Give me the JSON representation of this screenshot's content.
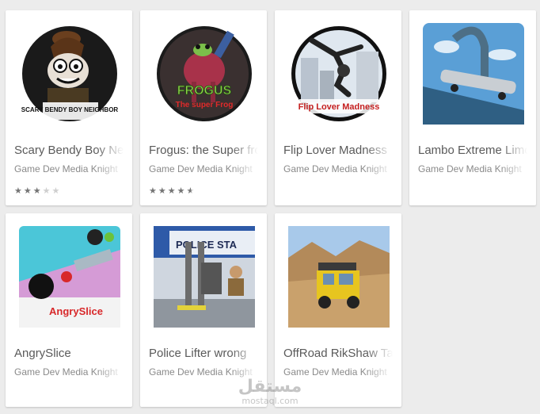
{
  "apps": [
    {
      "title": "Scary Bendy Boy Neighbor",
      "developer": "Game Dev Media Knight",
      "rating_stars": 3,
      "icon_caption": "SCARY BENDY BOY NEIGHBOR",
      "icon": "cartoon-boy-icon"
    },
    {
      "title": "Frogus: the Super frog",
      "developer": "Game Dev Media Knight",
      "rating_stars": 4.5,
      "icon_caption": "FROGUS",
      "icon_subcaption": "The super Frog",
      "icon": "frog-icon"
    },
    {
      "title": "Flip Lover Madness",
      "developer": "Game Dev Media Knight",
      "icon_caption": "Flip Lover Madness",
      "icon": "flip-character-icon"
    },
    {
      "title": "Lambo Extreme Limo",
      "developer": "Game Dev Media Knight",
      "icon": "limo-stunt-icon"
    },
    {
      "title": "AngrySlice",
      "developer": "Game Dev Media Knight",
      "icon_caption": "AngrySlice",
      "icon": "bomb-slice-icon"
    },
    {
      "title": "Police Lifter wrong",
      "developer": "Game Dev Media Knight",
      "icon_caption": "POLICE STA",
      "icon": "forklift-icon"
    },
    {
      "title": "OffRoad RikShaw Taxi",
      "developer": "Game Dev Media Knight",
      "icon": "rickshaw-icon"
    }
  ],
  "watermark": {
    "arabic": "مستقل",
    "latin": "mostaql.com"
  }
}
